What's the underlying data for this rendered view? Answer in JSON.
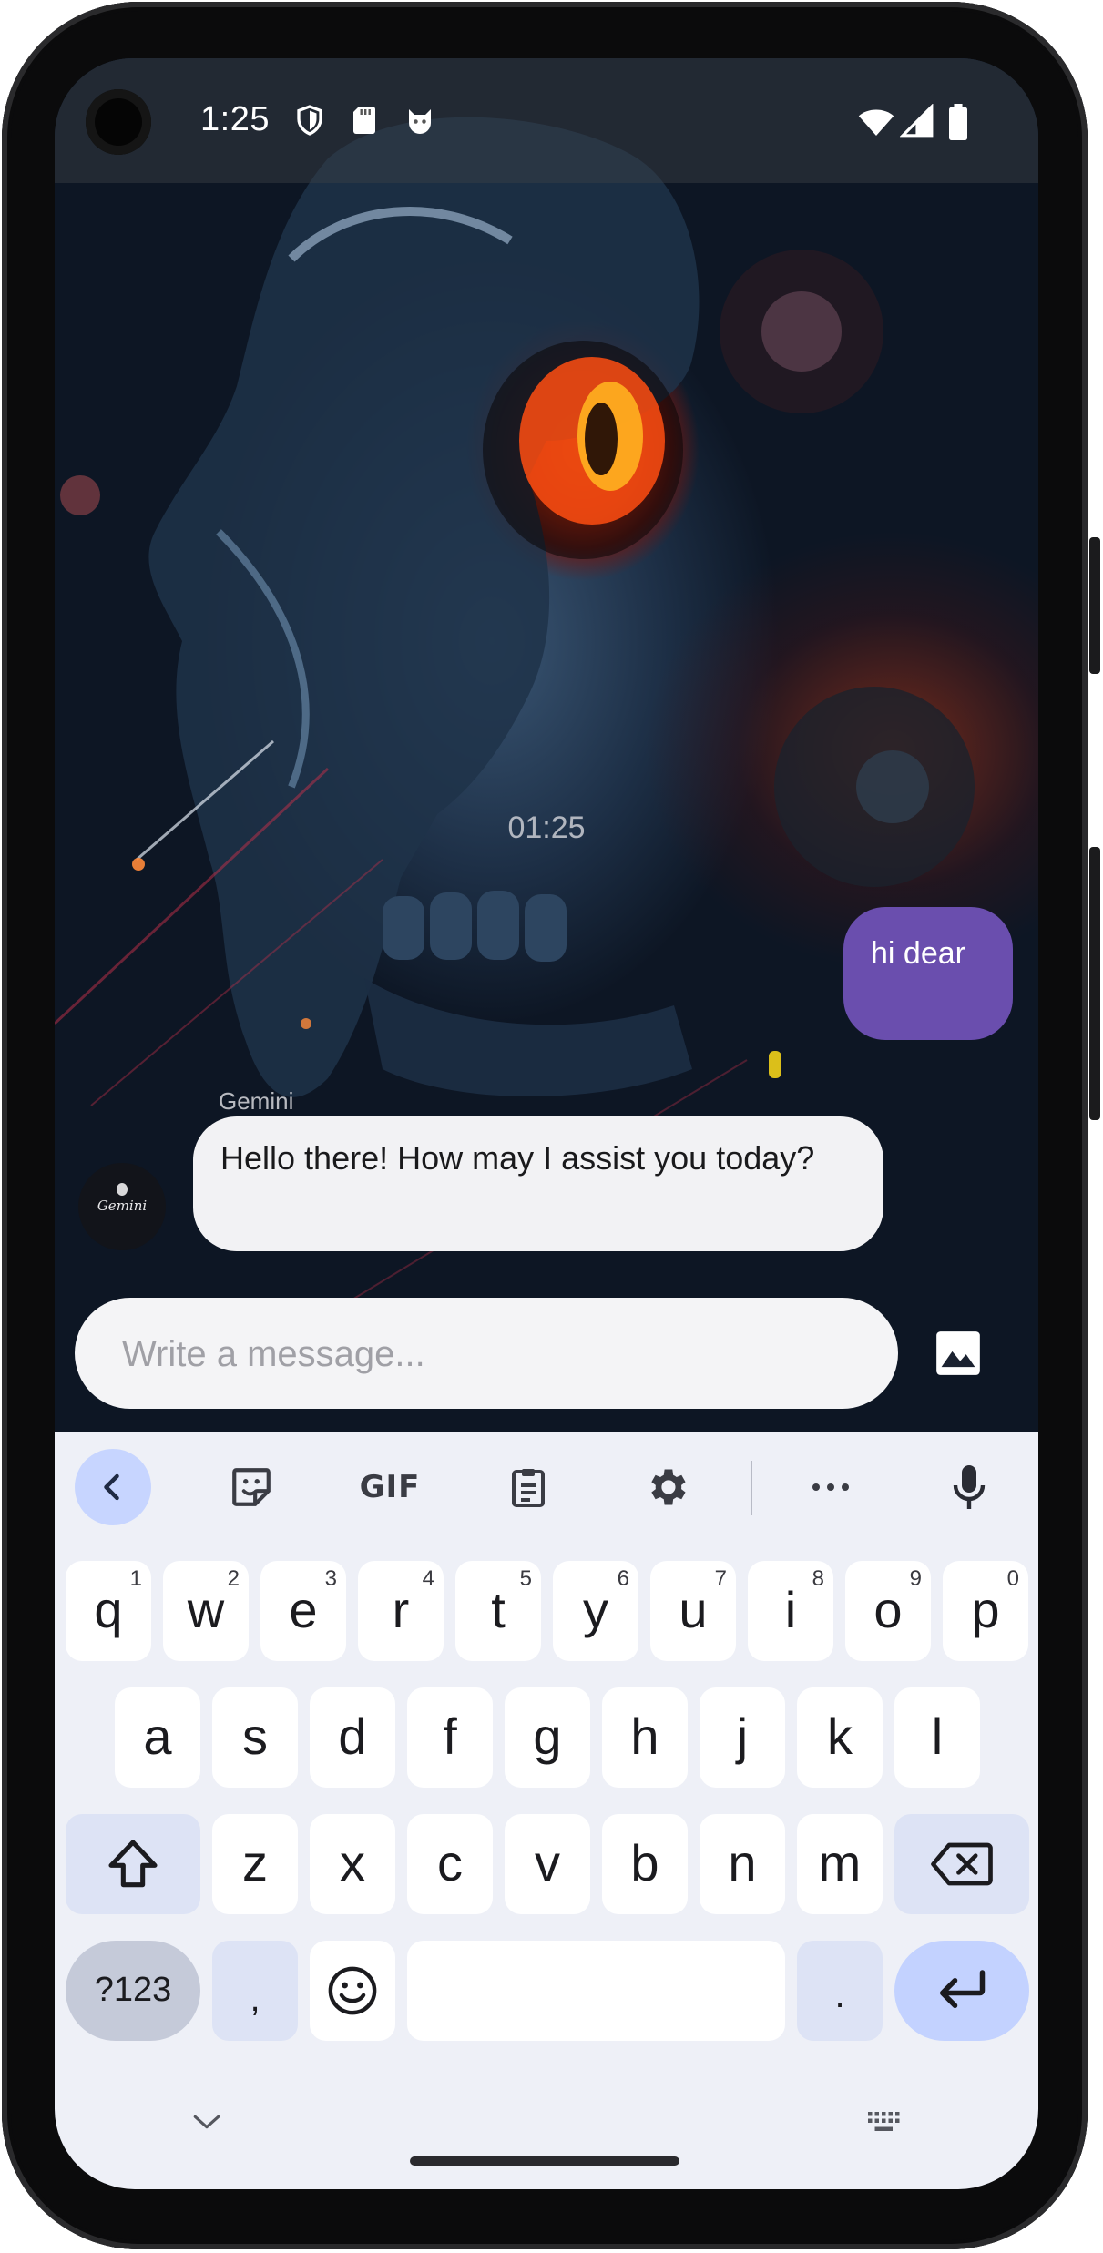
{
  "status_bar": {
    "time": "1:25",
    "icons": [
      "shield-icon",
      "sd-card-icon",
      "cat-face-icon",
      "wifi-icon",
      "signal-icon",
      "battery-icon"
    ]
  },
  "chat": {
    "timestamp": "01:25",
    "messages": [
      {
        "sender": "user",
        "text": "hi dear"
      },
      {
        "sender": "Gemini",
        "text": "Hello there! How may I assist you today?"
      }
    ],
    "avatar_label": "Gemini",
    "input_placeholder": "Write a message..."
  },
  "keyboard": {
    "toolbar": {
      "gif_label": "GIF",
      "icons": [
        "back-chevron-icon",
        "sticker-icon",
        "gif-icon",
        "clipboard-icon",
        "settings-icon",
        "more-icon",
        "microphone-icon"
      ]
    },
    "row1": [
      {
        "key": "q",
        "hint": "1"
      },
      {
        "key": "w",
        "hint": "2"
      },
      {
        "key": "e",
        "hint": "3"
      },
      {
        "key": "r",
        "hint": "4"
      },
      {
        "key": "t",
        "hint": "5"
      },
      {
        "key": "y",
        "hint": "6"
      },
      {
        "key": "u",
        "hint": "7"
      },
      {
        "key": "i",
        "hint": "8"
      },
      {
        "key": "o",
        "hint": "9"
      },
      {
        "key": "p",
        "hint": "0"
      }
    ],
    "row2": [
      "a",
      "s",
      "d",
      "f",
      "g",
      "h",
      "j",
      "k",
      "l"
    ],
    "row3": [
      "z",
      "x",
      "c",
      "v",
      "b",
      "n",
      "m"
    ],
    "row4": {
      "symbols": "?123",
      "comma": ",",
      "period": "."
    }
  },
  "colors": {
    "user_bubble": "#6a4eae",
    "bot_bubble": "#f2f2f4",
    "keyboard_bg": "#eef0f7",
    "enter_key": "#c3d2ff"
  }
}
